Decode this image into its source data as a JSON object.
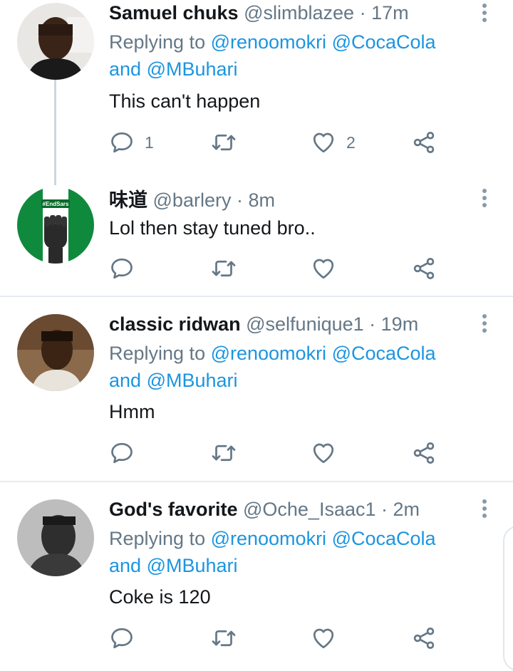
{
  "tweets": [
    {
      "name": "Samuel chuks",
      "handle": "@slimblazee",
      "time": "· 17m",
      "replying_prefix": "Replying to ",
      "mention1": "@renoomokri",
      "mention2": "@CocaCola",
      "and": "and ",
      "mention3": "@MBuhari",
      "text": "This can't happen",
      "reply_count": "1",
      "like_count": "2"
    },
    {
      "name": "味道",
      "handle": "@barlery",
      "time": "· 8m",
      "text": "Lol then stay tuned bro..",
      "avatar_text": "#EndSars"
    },
    {
      "name": "classic ridwan",
      "handle": "@selfunique1",
      "time": "· 19m",
      "replying_prefix": "Replying to ",
      "mention1": "@renoomokri",
      "mention2": "@CocaCola",
      "and": "and ",
      "mention3": "@MBuhari",
      "text": "Hmm"
    },
    {
      "name": "God's favorite",
      "handle": "@Oche_Isaac1",
      "time": "· 2m",
      "replying_prefix": "Replying to ",
      "mention1": "@renoomokri",
      "mention2": "@CocaCola",
      "and": "and ",
      "mention3": "@MBuhari",
      "text": "Coke is 120"
    }
  ],
  "colors": {
    "link": "#1b95e0",
    "muted": "#657786",
    "divider": "#e6ecf0"
  }
}
